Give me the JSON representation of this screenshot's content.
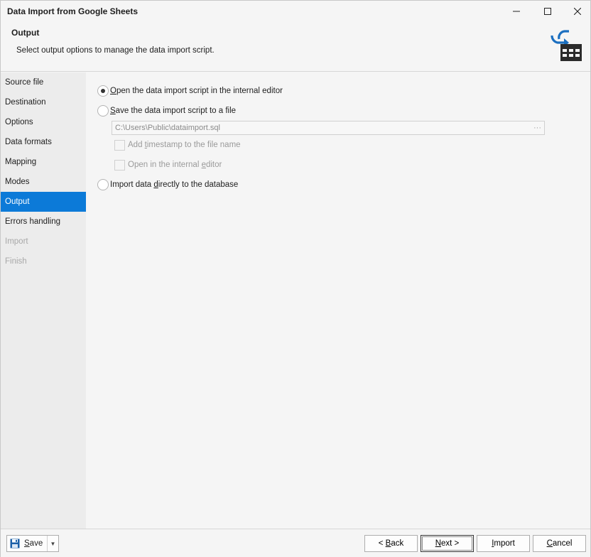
{
  "window": {
    "title": "Data Import from Google Sheets",
    "controls": {
      "minimize": "—",
      "maximize": "☐",
      "close": "✕"
    }
  },
  "header": {
    "title": "Output",
    "subtitle": "Select output options to manage the data import script.",
    "icon": "data-import-table-icon"
  },
  "sidebar": {
    "items": [
      {
        "label": "Source file",
        "state": "normal"
      },
      {
        "label": "Destination",
        "state": "normal"
      },
      {
        "label": "Options",
        "state": "normal"
      },
      {
        "label": "Data formats",
        "state": "normal"
      },
      {
        "label": "Mapping",
        "state": "normal"
      },
      {
        "label": "Modes",
        "state": "normal"
      },
      {
        "label": "Output",
        "state": "active"
      },
      {
        "label": "Errors handling",
        "state": "normal"
      },
      {
        "label": "Import",
        "state": "disabled"
      },
      {
        "label": "Finish",
        "state": "disabled"
      }
    ]
  },
  "options": {
    "open_editor": {
      "access_key": "O",
      "rest": "pen the data import script in the internal editor",
      "checked": true
    },
    "save_file": {
      "access_key": "S",
      "rest": "ave the data import script to a file",
      "checked": false
    },
    "file_path": "C:\\Users\\Public\\dataimport.sql",
    "file_path_button": "···",
    "add_timestamp": {
      "before": "Add ",
      "access_key": "t",
      "after": "imestamp to the file name",
      "checked": false
    },
    "open_internal": {
      "before": "Open in the internal ",
      "access_key": "e",
      "after": "ditor",
      "checked": false
    },
    "import_direct": {
      "before": "Import data ",
      "access_key": "d",
      "after": "irectly to the database",
      "checked": false
    }
  },
  "footer": {
    "save": {
      "access_key": "S",
      "rest": "ave",
      "icon": "floppy-disk-icon",
      "dropdown": "▼"
    },
    "back": {
      "before": "< ",
      "access_key": "B",
      "after": "ack"
    },
    "next": {
      "access_key": "N",
      "after": "ext >"
    },
    "import": {
      "access_key": "I",
      "after": "mport"
    },
    "cancel": {
      "access_key": "C",
      "after": "ancel"
    }
  },
  "colors": {
    "accent": "#0c7ad8",
    "icon_blue": "#1b6fc0",
    "icon_dark": "#2b2b2b"
  }
}
